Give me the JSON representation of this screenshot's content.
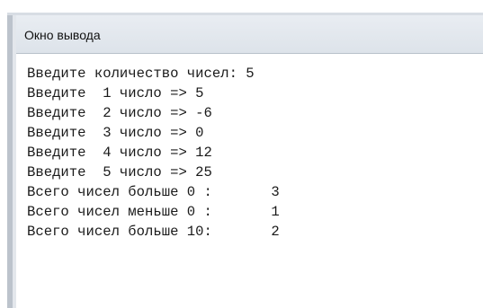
{
  "window": {
    "title": "Окно вывода"
  },
  "output": {
    "lines": [
      "Введите количество чисел: 5",
      "Введите  1 число => 5",
      "Введите  2 число => -6",
      "Введите  3 число => 0",
      "Введите  4 число => 12",
      "Введите  5 число => 25",
      "Всего чисел больше 0 :       3",
      "Всего чисел меньше 0 :       1",
      "Всего чисел больше 10:       2"
    ]
  },
  "colors": {
    "title_bar": "#e3e8ee",
    "text": "#1a1a1a",
    "background": "#ffffff"
  }
}
